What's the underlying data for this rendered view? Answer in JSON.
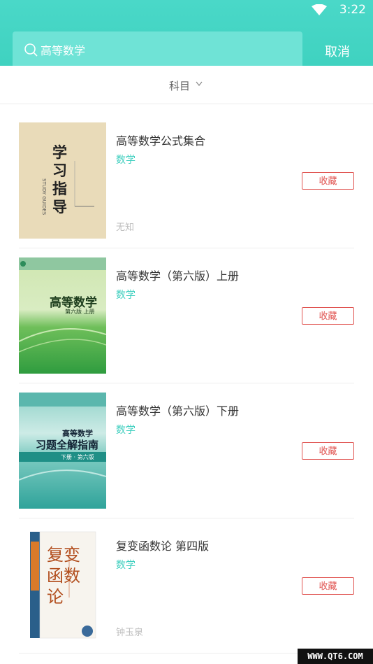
{
  "status": {
    "time": "3:22"
  },
  "search": {
    "query": "高等数学",
    "cancel_label": "取消"
  },
  "filter": {
    "label": "科目"
  },
  "books": [
    {
      "title": "高等数学公式集合",
      "subject": "数学",
      "author": "无知",
      "fav_label": "收藏",
      "cover": {
        "text_main": "学习指导",
        "text_en": "STUDY GUIDES"
      }
    },
    {
      "title": "高等数学（第六版）上册",
      "subject": "数学",
      "author": "",
      "fav_label": "收藏",
      "cover": {
        "title": "高等数学",
        "sub": "第六版 上册"
      }
    },
    {
      "title": "高等数学（第六版）下册",
      "subject": "数学",
      "author": "",
      "fav_label": "收藏",
      "cover": {
        "title1": "高等数学",
        "title2": "习题全解指南",
        "sub": "下册 · 第六版"
      }
    },
    {
      "title": "复变函数论 第四版",
      "subject": "数学",
      "author": "钟玉泉",
      "fav_label": "收藏",
      "cover": {
        "title": "复变函数论"
      }
    }
  ],
  "watermark": "WWW.QT6.COM",
  "colors": {
    "accent": "#3fd2c0",
    "favorite": "#e0524f"
  }
}
